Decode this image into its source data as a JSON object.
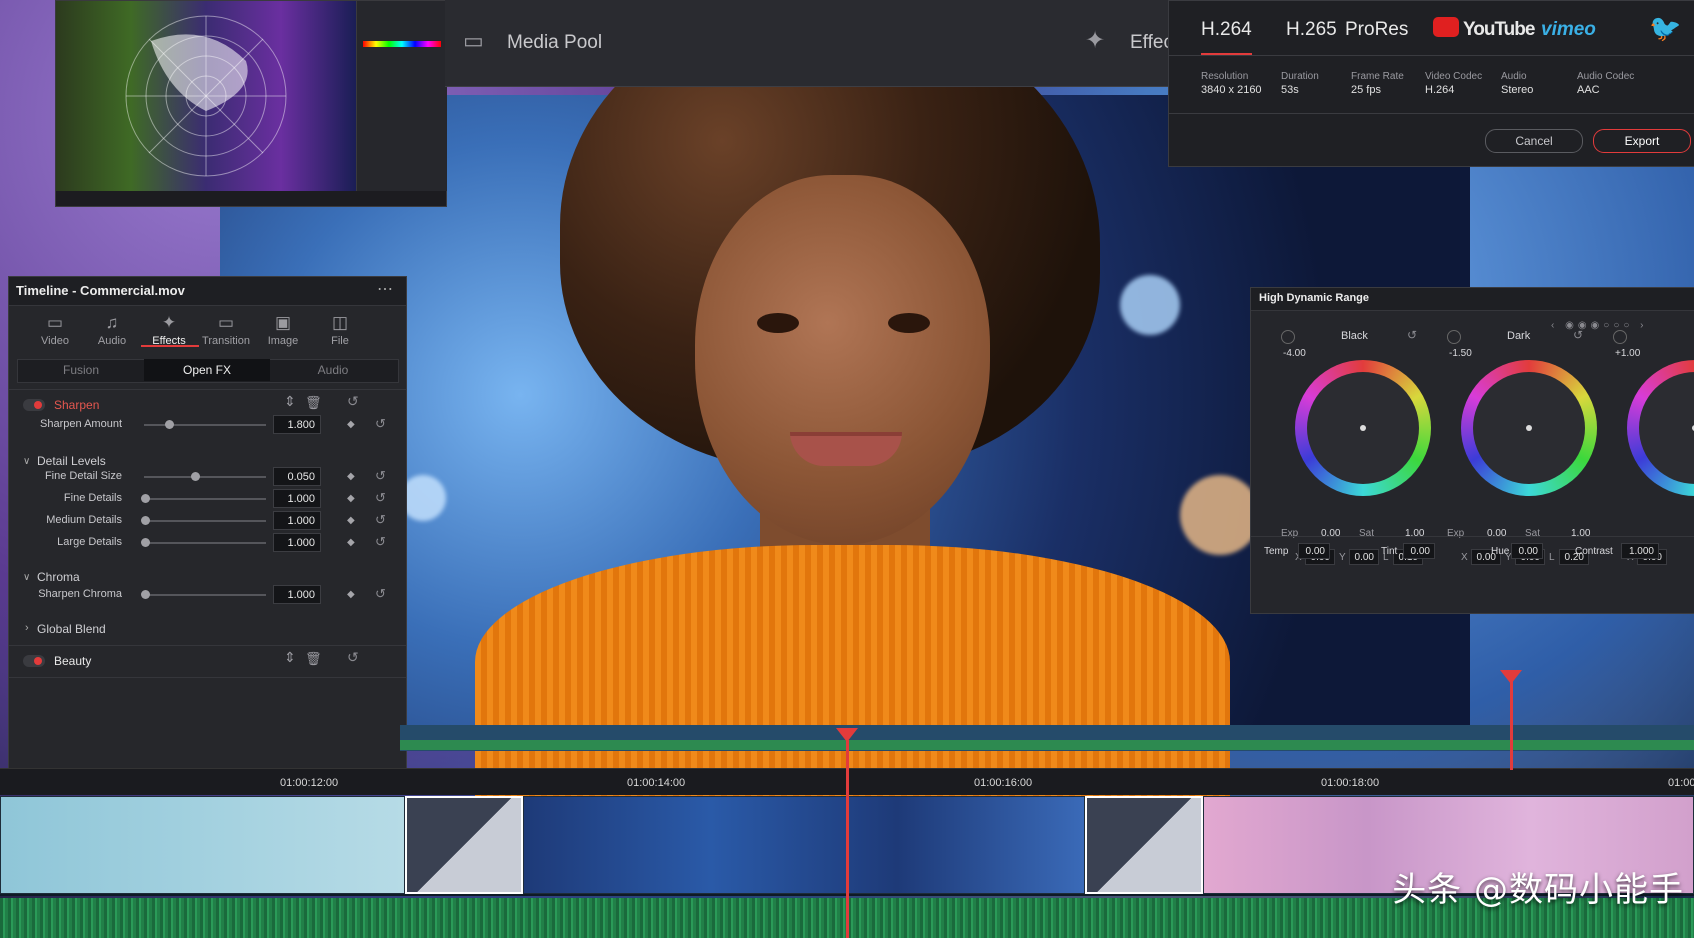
{
  "top_toolbar": {
    "media_pool": "Media Pool",
    "effects_partial": "Effec"
  },
  "export_panel": {
    "formats": [
      "H.264",
      "H.265",
      "ProRes"
    ],
    "platforms": {
      "youtube": "YouTube",
      "vimeo": "vimeo"
    },
    "meta": [
      {
        "key": "Resolution",
        "value": "3840 x 2160"
      },
      {
        "key": "Duration",
        "value": "53s"
      },
      {
        "key": "Frame Rate",
        "value": "25 fps"
      },
      {
        "key": "Video Codec",
        "value": "H.264"
      },
      {
        "key": "Audio",
        "value": "Stereo"
      },
      {
        "key": "Audio Codec",
        "value": "AAC"
      }
    ],
    "cancel": "Cancel",
    "export": "Export"
  },
  "inspector": {
    "title": "Timeline - Commercial.mov",
    "tabs": [
      "Video",
      "Audio",
      "Effects",
      "Transition",
      "Image",
      "File"
    ],
    "active_tab": "Effects",
    "segments": [
      "Fusion",
      "Open FX",
      "Audio"
    ],
    "active_segment": "Open FX",
    "sharpen": {
      "name": "Sharpen",
      "amount_label": "Sharpen Amount",
      "amount": "1.800",
      "amount_frac": 0.2
    },
    "detail_levels": {
      "name": "Detail Levels",
      "rows": [
        {
          "label": "Fine Detail Size",
          "value": "0.050",
          "frac": 0.42
        },
        {
          "label": "Fine Details",
          "value": "1.000",
          "frac": 0.0
        },
        {
          "label": "Medium Details",
          "value": "1.000",
          "frac": 0.0
        },
        {
          "label": "Large Details",
          "value": "1.000",
          "frac": 0.0
        }
      ]
    },
    "chroma": {
      "name": "Chroma",
      "label": "Sharpen Chroma",
      "value": "1.000",
      "frac": 0.0
    },
    "global_blend": "Global Blend",
    "beauty": "Beauty"
  },
  "hdr_panel": {
    "title": "High Dynamic Range",
    "wheels": [
      {
        "name": "Black",
        "offset": "-4.00",
        "exp": "0.00",
        "sat": "1.00",
        "x": "0.00",
        "y": "0.00",
        "l": "0.10"
      },
      {
        "name": "Dark",
        "offset": "-1.50",
        "exp": "0.00",
        "sat": "1.00",
        "x": "0.00",
        "y": "0.00",
        "l": "0.20"
      },
      {
        "name": "",
        "offset": "+1.00",
        "exp": "",
        "sat": "",
        "x": "0.00",
        "y": "",
        "l": ""
      }
    ],
    "exp_label": "Exp",
    "sat_label": "Sat",
    "x_label": "X",
    "y_label": "Y",
    "l_label": "L",
    "temp_label": "Temp",
    "temp": "0.00",
    "tint_label": "Tint",
    "tint": "0.00",
    "hue_label": "Hue",
    "hue": "0.00",
    "contrast_label": "Contrast",
    "contrast": "1.000"
  },
  "timeline": {
    "timecodes": [
      "01:00:12:00",
      "01:00:14:00",
      "01:00:16:00",
      "01:00:18:00",
      "01:00"
    ]
  },
  "watermark": "头条 @数码小能手",
  "colors": {
    "accent_red": "#e23b3b",
    "panel": "#24252a",
    "sweater": "#f08a1a"
  }
}
